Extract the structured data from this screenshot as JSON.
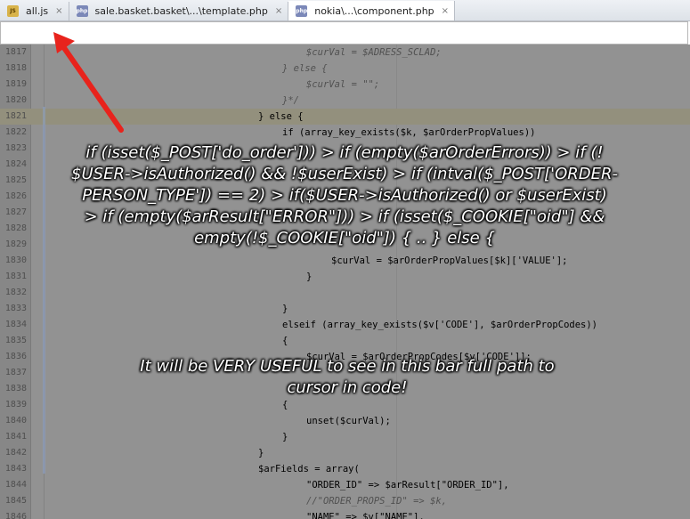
{
  "tabs": [
    {
      "name": "all-js",
      "icon": "js-file-icon",
      "icon_text": "JS",
      "label": "all.js",
      "close": "×",
      "active": false
    },
    {
      "name": "template-php",
      "icon": "php-file-icon",
      "icon_text": "php",
      "label": "sale.basket.basket\\...\\template.php",
      "close": "×",
      "active": false
    },
    {
      "name": "component-php",
      "icon": "php-file-icon",
      "icon_text": "php",
      "label": "nokia\\...\\component.php",
      "close": "×",
      "active": true
    }
  ],
  "code_lines": [
    {
      "num": "1817",
      "indent": 344,
      "text": "$curVal = $ADRESS_SCLAD;",
      "color": "#8c8c8c",
      "italic": true
    },
    {
      "num": "1818",
      "indent": 317,
      "text": "} else {",
      "color": "#8c8c8c",
      "italic": true
    },
    {
      "num": "1819",
      "indent": 344,
      "text": "$curVal = \"\";",
      "color": "#8c8c8c",
      "italic": true
    },
    {
      "num": "1820",
      "indent": 317,
      "text": "}*/",
      "color": "#8c8c8c",
      "italic": true
    },
    {
      "num": "1821",
      "indent": 290,
      "text": "} else {",
      "color": "#000000",
      "italic": false,
      "highlight": true
    },
    {
      "num": "1822",
      "indent": 317,
      "text": "if (array_key_exists($k, $arOrderPropValues))",
      "color": "#000000",
      "italic": false
    },
    {
      "num": "1823",
      "indent": 317,
      "text": "",
      "color": "#000000",
      "italic": false
    },
    {
      "num": "1824",
      "indent": 317,
      "text": "",
      "color": "#000000",
      "italic": false
    },
    {
      "num": "1825",
      "indent": 317,
      "text": "",
      "color": "#000000",
      "italic": false
    },
    {
      "num": "1826",
      "indent": 317,
      "text": "",
      "color": "#000000",
      "italic": false
    },
    {
      "num": "1827",
      "indent": 317,
      "text": "",
      "color": "#000000",
      "italic": false
    },
    {
      "num": "1828",
      "indent": 317,
      "text": "",
      "color": "#000000",
      "italic": false
    },
    {
      "num": "1829",
      "indent": 344,
      "text": "",
      "color": "#000000",
      "italic": false
    },
    {
      "num": "1830",
      "indent": 372,
      "text": "$curVal = $arOrderPropValues[$k]['VALUE'];",
      "color": "#000000",
      "italic": false
    },
    {
      "num": "1831",
      "indent": 344,
      "text": "}",
      "color": "#000000",
      "italic": false
    },
    {
      "num": "1832",
      "indent": 317,
      "text": "",
      "color": "#000000",
      "italic": false
    },
    {
      "num": "1833",
      "indent": 317,
      "text": "}",
      "color": "#000000",
      "italic": false
    },
    {
      "num": "1834",
      "indent": 317,
      "text": "elseif (array_key_exists($v['CODE'], $arOrderPropCodes))",
      "color": "#000000",
      "italic": false
    },
    {
      "num": "1835",
      "indent": 317,
      "text": "{",
      "color": "#000000",
      "italic": false
    },
    {
      "num": "1836",
      "indent": 344,
      "text": "$curVal = $arOrderPropCodes[$v['CODE']];",
      "color": "#000000",
      "italic": false
    },
    {
      "num": "1837",
      "indent": 317,
      "text": "",
      "color": "#000000",
      "italic": false
    },
    {
      "num": "1838",
      "indent": 317,
      "text": "",
      "color": "#000000",
      "italic": false
    },
    {
      "num": "1839",
      "indent": 317,
      "text": "{",
      "color": "#000000",
      "italic": false
    },
    {
      "num": "1840",
      "indent": 344,
      "text": "unset($curVal);",
      "color": "#000000",
      "italic": false
    },
    {
      "num": "1841",
      "indent": 317,
      "text": "}",
      "color": "#000000",
      "italic": false
    },
    {
      "num": "1842",
      "indent": 290,
      "text": "}",
      "color": "#000000",
      "italic": false
    },
    {
      "num": "1843",
      "indent": 290,
      "text": "$arFields = array(",
      "color": "#000000",
      "italic": false
    },
    {
      "num": "1844",
      "indent": 344,
      "text": "\"ORDER_ID\" => $arResult[\"ORDER_ID\"],",
      "color": "#000000",
      "italic": false
    },
    {
      "num": "1845",
      "indent": 344,
      "text": "//\"ORDER_PROPS_ID\" => $k,",
      "color": "#8c8c8c",
      "italic": true
    },
    {
      "num": "1846",
      "indent": 344,
      "text": "\"NAME\" => $v[\"NAME\"],",
      "color": "#000000",
      "italic": false
    }
  ],
  "annotations": {
    "breadcrumb_line1": "if (isset($_POST['do_order']))  >  if (empty($arOrderErrors))  >  if (!",
    "breadcrumb_line2": "$USER->isAuthorized() && !$userExist)  >  if (intval($_POST['ORDER-",
    "breadcrumb_line3": "PERSON_TYPE']) == 2)  >  if($USER->isAuthorized() or $userExist)",
    "breadcrumb_line4": ">  if (empty($arResult[\"ERROR\"]))  >  if (isset($_COOKIE[\"oid\"] &&",
    "breadcrumb_line5": "empty(!$_COOKIE[\"oid\"]) { .. } else {",
    "note_line1": "It will be VERY USEFUL to see in this bar full path to",
    "note_line2": "cursor in code!"
  },
  "colors": {
    "arrow": "#e8231c",
    "keyword": "#000080",
    "string": "#008000",
    "comment": "#8c8c8c"
  }
}
